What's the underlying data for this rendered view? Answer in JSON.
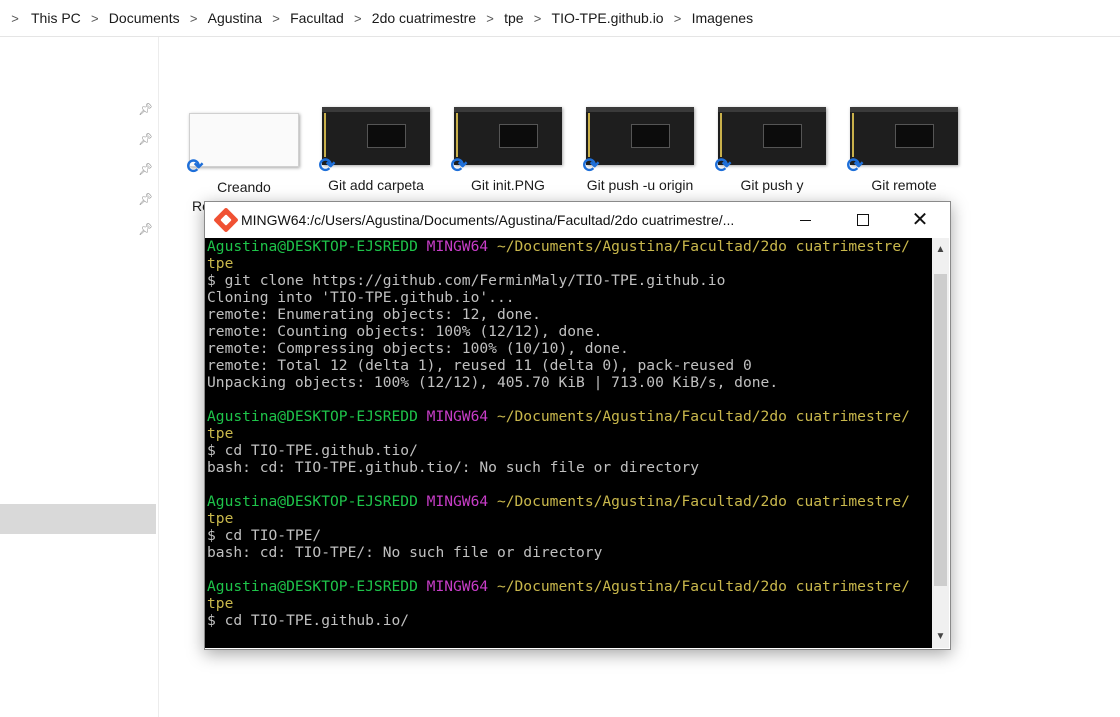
{
  "breadcrumb": {
    "items": [
      "This PC",
      "Documents",
      "Agustina",
      "Facultad",
      "2do cuatrimestre",
      "tpe",
      "TIO-TPE.github.io",
      "Imagenes"
    ],
    "separator": ">"
  },
  "files": [
    {
      "label": "Creando",
      "style": "light",
      "icon": "sync-icon"
    },
    {
      "label": "Git add carpeta",
      "style": "dark",
      "icon": "sync-icon"
    },
    {
      "label": "Git init.PNG",
      "style": "dark",
      "icon": "sync-icon"
    },
    {
      "label": "Git push -u origin",
      "style": "dark",
      "icon": "sync-icon"
    },
    {
      "label": "Git push y",
      "style": "dark",
      "icon": "sync-icon"
    },
    {
      "label": "Git remote",
      "style": "dark",
      "icon": "sync-icon"
    }
  ],
  "partial_label": "Re",
  "terminal": {
    "title": "MINGW64:/c/Users/Agustina/Documents/Agustina/Facultad/2do cuatrimestre/...",
    "colors": {
      "background": "#000000",
      "user": "#1ec44a",
      "env": "#c73dc7",
      "path": "#c9b84c",
      "text": "#c0c0c0"
    },
    "lines": [
      [
        {
          "t": "Agustina@DESKTOP-EJSREDD ",
          "c": "green"
        },
        {
          "t": "MINGW64 ",
          "c": "magenta"
        },
        {
          "t": "~/Documents/Agustina/Facultad/2do cuatrimestre/",
          "c": "yellow"
        }
      ],
      [
        {
          "t": "tpe",
          "c": "yellow"
        }
      ],
      [
        {
          "t": "$ git clone https://github.com/FerminMaly/TIO-TPE.github.io",
          "c": "white"
        }
      ],
      [
        {
          "t": "Cloning into 'TIO-TPE.github.io'...",
          "c": "white"
        }
      ],
      [
        {
          "t": "remote: Enumerating objects: 12, done.",
          "c": "white"
        }
      ],
      [
        {
          "t": "remote: Counting objects: 100% (12/12), done.",
          "c": "white"
        }
      ],
      [
        {
          "t": "remote: Compressing objects: 100% (10/10), done.",
          "c": "white"
        }
      ],
      [
        {
          "t": "remote: Total 12 (delta 1), reused 11 (delta 0), pack-reused 0",
          "c": "white"
        }
      ],
      [
        {
          "t": "Unpacking objects: 100% (12/12), 405.70 KiB | 713.00 KiB/s, done.",
          "c": "white"
        }
      ],
      [],
      [
        {
          "t": "Agustina@DESKTOP-EJSREDD ",
          "c": "green"
        },
        {
          "t": "MINGW64 ",
          "c": "magenta"
        },
        {
          "t": "~/Documents/Agustina/Facultad/2do cuatrimestre/",
          "c": "yellow"
        }
      ],
      [
        {
          "t": "tpe",
          "c": "yellow"
        }
      ],
      [
        {
          "t": "$ cd TIO-TPE.github.tio/",
          "c": "white"
        }
      ],
      [
        {
          "t": "bash: cd: TIO-TPE.github.tio/: No such file or directory",
          "c": "white"
        }
      ],
      [],
      [
        {
          "t": "Agustina@DESKTOP-EJSREDD ",
          "c": "green"
        },
        {
          "t": "MINGW64 ",
          "c": "magenta"
        },
        {
          "t": "~/Documents/Agustina/Facultad/2do cuatrimestre/",
          "c": "yellow"
        }
      ],
      [
        {
          "t": "tpe",
          "c": "yellow"
        }
      ],
      [
        {
          "t": "$ cd TIO-TPE/",
          "c": "white"
        }
      ],
      [
        {
          "t": "bash: cd: TIO-TPE/: No such file or directory",
          "c": "white"
        }
      ],
      [],
      [
        {
          "t": "Agustina@DESKTOP-EJSREDD ",
          "c": "green"
        },
        {
          "t": "MINGW64 ",
          "c": "magenta"
        },
        {
          "t": "~/Documents/Agustina/Facultad/2do cuatrimestre/",
          "c": "yellow"
        }
      ],
      [
        {
          "t": "tpe",
          "c": "yellow"
        }
      ],
      [
        {
          "t": "$ cd TIO-TPE.github.io/",
          "c": "white"
        }
      ]
    ]
  }
}
